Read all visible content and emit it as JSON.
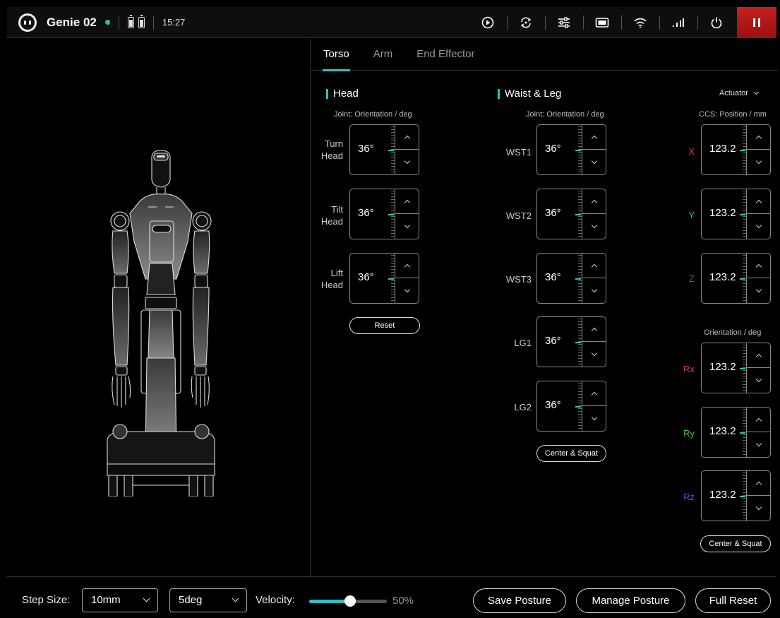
{
  "header": {
    "robot_name": "Genie 02",
    "time": "15:27",
    "icons": [
      "play-circle-icon",
      "rotate-icon",
      "sliders-icon",
      "display-icon",
      "wifi-icon",
      "signal-icon",
      "power-icon",
      "pause-icon"
    ]
  },
  "tabs": [
    {
      "label": "Torso",
      "active": true
    },
    {
      "label": "Arm",
      "active": false
    },
    {
      "label": "End Effector",
      "active": false
    }
  ],
  "head": {
    "title": "Head",
    "sublabel": "Joint:  Orientation / deg",
    "joints": [
      {
        "label": "Turn\nHead",
        "value": "36°"
      },
      {
        "label": "Tilt\nHead",
        "value": "36°"
      },
      {
        "label": "Lift\nHead",
        "value": "36°"
      }
    ],
    "reset_label": "Reset"
  },
  "waist": {
    "title": "Waist & Leg",
    "sublabel": "Joint:  Orientation / deg",
    "joints": [
      {
        "label": "WST1",
        "value": "36°"
      },
      {
        "label": "WST2",
        "value": "36°"
      },
      {
        "label": "WST3",
        "value": "36°"
      },
      {
        "label": "LG1",
        "value": "36°"
      },
      {
        "label": "LG2",
        "value": "36°"
      }
    ],
    "button_label": "Center & Squat"
  },
  "ccs": {
    "dropdown": "Actuator",
    "position_label": "CCS: Position / mm",
    "orientation_label": "Orientation / deg",
    "position": [
      {
        "axis": "X",
        "value": "123.2",
        "color": "#e53935"
      },
      {
        "axis": "Y",
        "value": "123.2",
        "color": "#2ecc40"
      },
      {
        "axis": "Z",
        "value": "123.2",
        "color": "#2f5fe0"
      }
    ],
    "orientation": [
      {
        "axis": "Rx",
        "value": "123.2",
        "color": "#e53935"
      },
      {
        "axis": "Ry",
        "value": "123.2",
        "color": "#2ecc40"
      },
      {
        "axis": "Rz",
        "value": "123.2",
        "color": "#2f5fe0"
      }
    ],
    "button_label": "Center & Squat"
  },
  "bottom": {
    "step_label": "Step Size:",
    "step_mm": "10mm",
    "step_deg": "5deg",
    "velocity_label": "Velocity:",
    "velocity_value": 0.5,
    "velocity_text": "50%",
    "save_label": "Save Posture",
    "manage_label": "Manage Posture",
    "reset_label": "Full Reset"
  },
  "colors": {
    "accent": "#2bc1c1",
    "stop": "#c62020"
  }
}
